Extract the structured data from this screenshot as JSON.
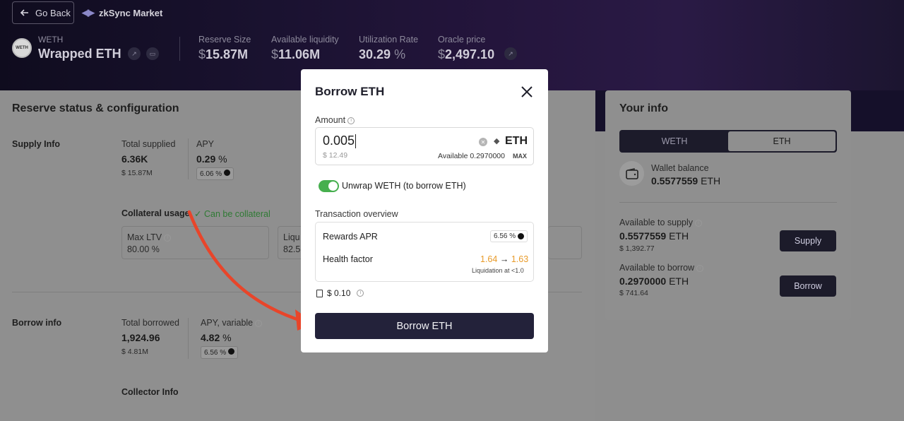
{
  "header": {
    "back_label": "Go Back",
    "market_name": "zkSync Market",
    "asset_symbol": "WETH",
    "asset_name": "Wrapped ETH",
    "asset_logo_text": "WETH",
    "stats": [
      {
        "label": "Reserve Size",
        "prefix": "$",
        "value": "15.87M",
        "suffix": ""
      },
      {
        "label": "Available liquidity",
        "prefix": "$",
        "value": "11.06M",
        "suffix": ""
      },
      {
        "label": "Utilization Rate",
        "prefix": "",
        "value": "30.29",
        "suffix": "%"
      },
      {
        "label": "Oracle price",
        "prefix": "$",
        "value": "2,497.10",
        "suffix": ""
      }
    ]
  },
  "reserve": {
    "title": "Reserve status & configuration",
    "supply_info_label": "Supply Info",
    "total_supplied_label": "Total supplied",
    "total_supplied_value": "6.36K",
    "total_supplied_usd": "$ 15.87M",
    "supply_apy_label": "APY",
    "supply_apy_value": "0.29",
    "supply_apy_pill": "6.06 %",
    "collateral_usage_label": "Collateral usage",
    "can_be_collateral": "Can be collateral",
    "max_ltv_label": "Max LTV",
    "max_ltv_value": "80.00",
    "liq_label": "Liqu",
    "liq_value": "82.5",
    "borrow_info_label": "Borrow info",
    "total_borrowed_label": "Total borrowed",
    "total_borrowed_value": "1,924.96",
    "total_borrowed_usd": "$ 4.81M",
    "borrow_apy_label": "APY, variable",
    "borrow_apy_value": "4.82",
    "borrow_apy_pill": "6.56 %",
    "collector_info_label": "Collector Info",
    "percent_sign": "%"
  },
  "your_info": {
    "title": "Your info",
    "tabs": [
      "WETH",
      "ETH"
    ],
    "active_tab": "ETH",
    "wallet_balance_label": "Wallet balance",
    "wallet_balance_value": "0.5577559",
    "wallet_balance_unit": "ETH",
    "available_supply_label": "Available to supply",
    "available_supply_value": "0.5577559",
    "available_supply_unit": "ETH",
    "available_supply_usd": "$ 1,392.77",
    "supply_button": "Supply",
    "available_borrow_label": "Available to borrow",
    "available_borrow_value": "0.2970000",
    "available_borrow_unit": "ETH",
    "available_borrow_usd": "$ 741.64",
    "borrow_button": "Borrow"
  },
  "modal": {
    "title": "Borrow ETH",
    "amount_label": "Amount",
    "amount_value": "0.005",
    "amount_usd": "$ 12.49",
    "token": "ETH",
    "available_text": "Available 0.2970000",
    "max_label": "MAX",
    "unwrap_label": "Unwrap WETH (to borrow ETH)",
    "unwrap_enabled": true,
    "overview_label": "Transaction overview",
    "rewards_apr_label": "Rewards APR",
    "rewards_apr_value": "6.56 %",
    "health_factor_label": "Health factor",
    "health_from": "1.64",
    "health_to": "1.63",
    "health_arrow": "→",
    "liquidation_note": "Liquidation at <1.0",
    "gas_value": "$ 0.10",
    "submit_label": "Borrow ETH"
  },
  "colors": {
    "accent_dark": "#23223a",
    "toggle_green": "#46af4e",
    "health_orange": "#e89b2a",
    "annotation_arrow": "#e8452a"
  }
}
